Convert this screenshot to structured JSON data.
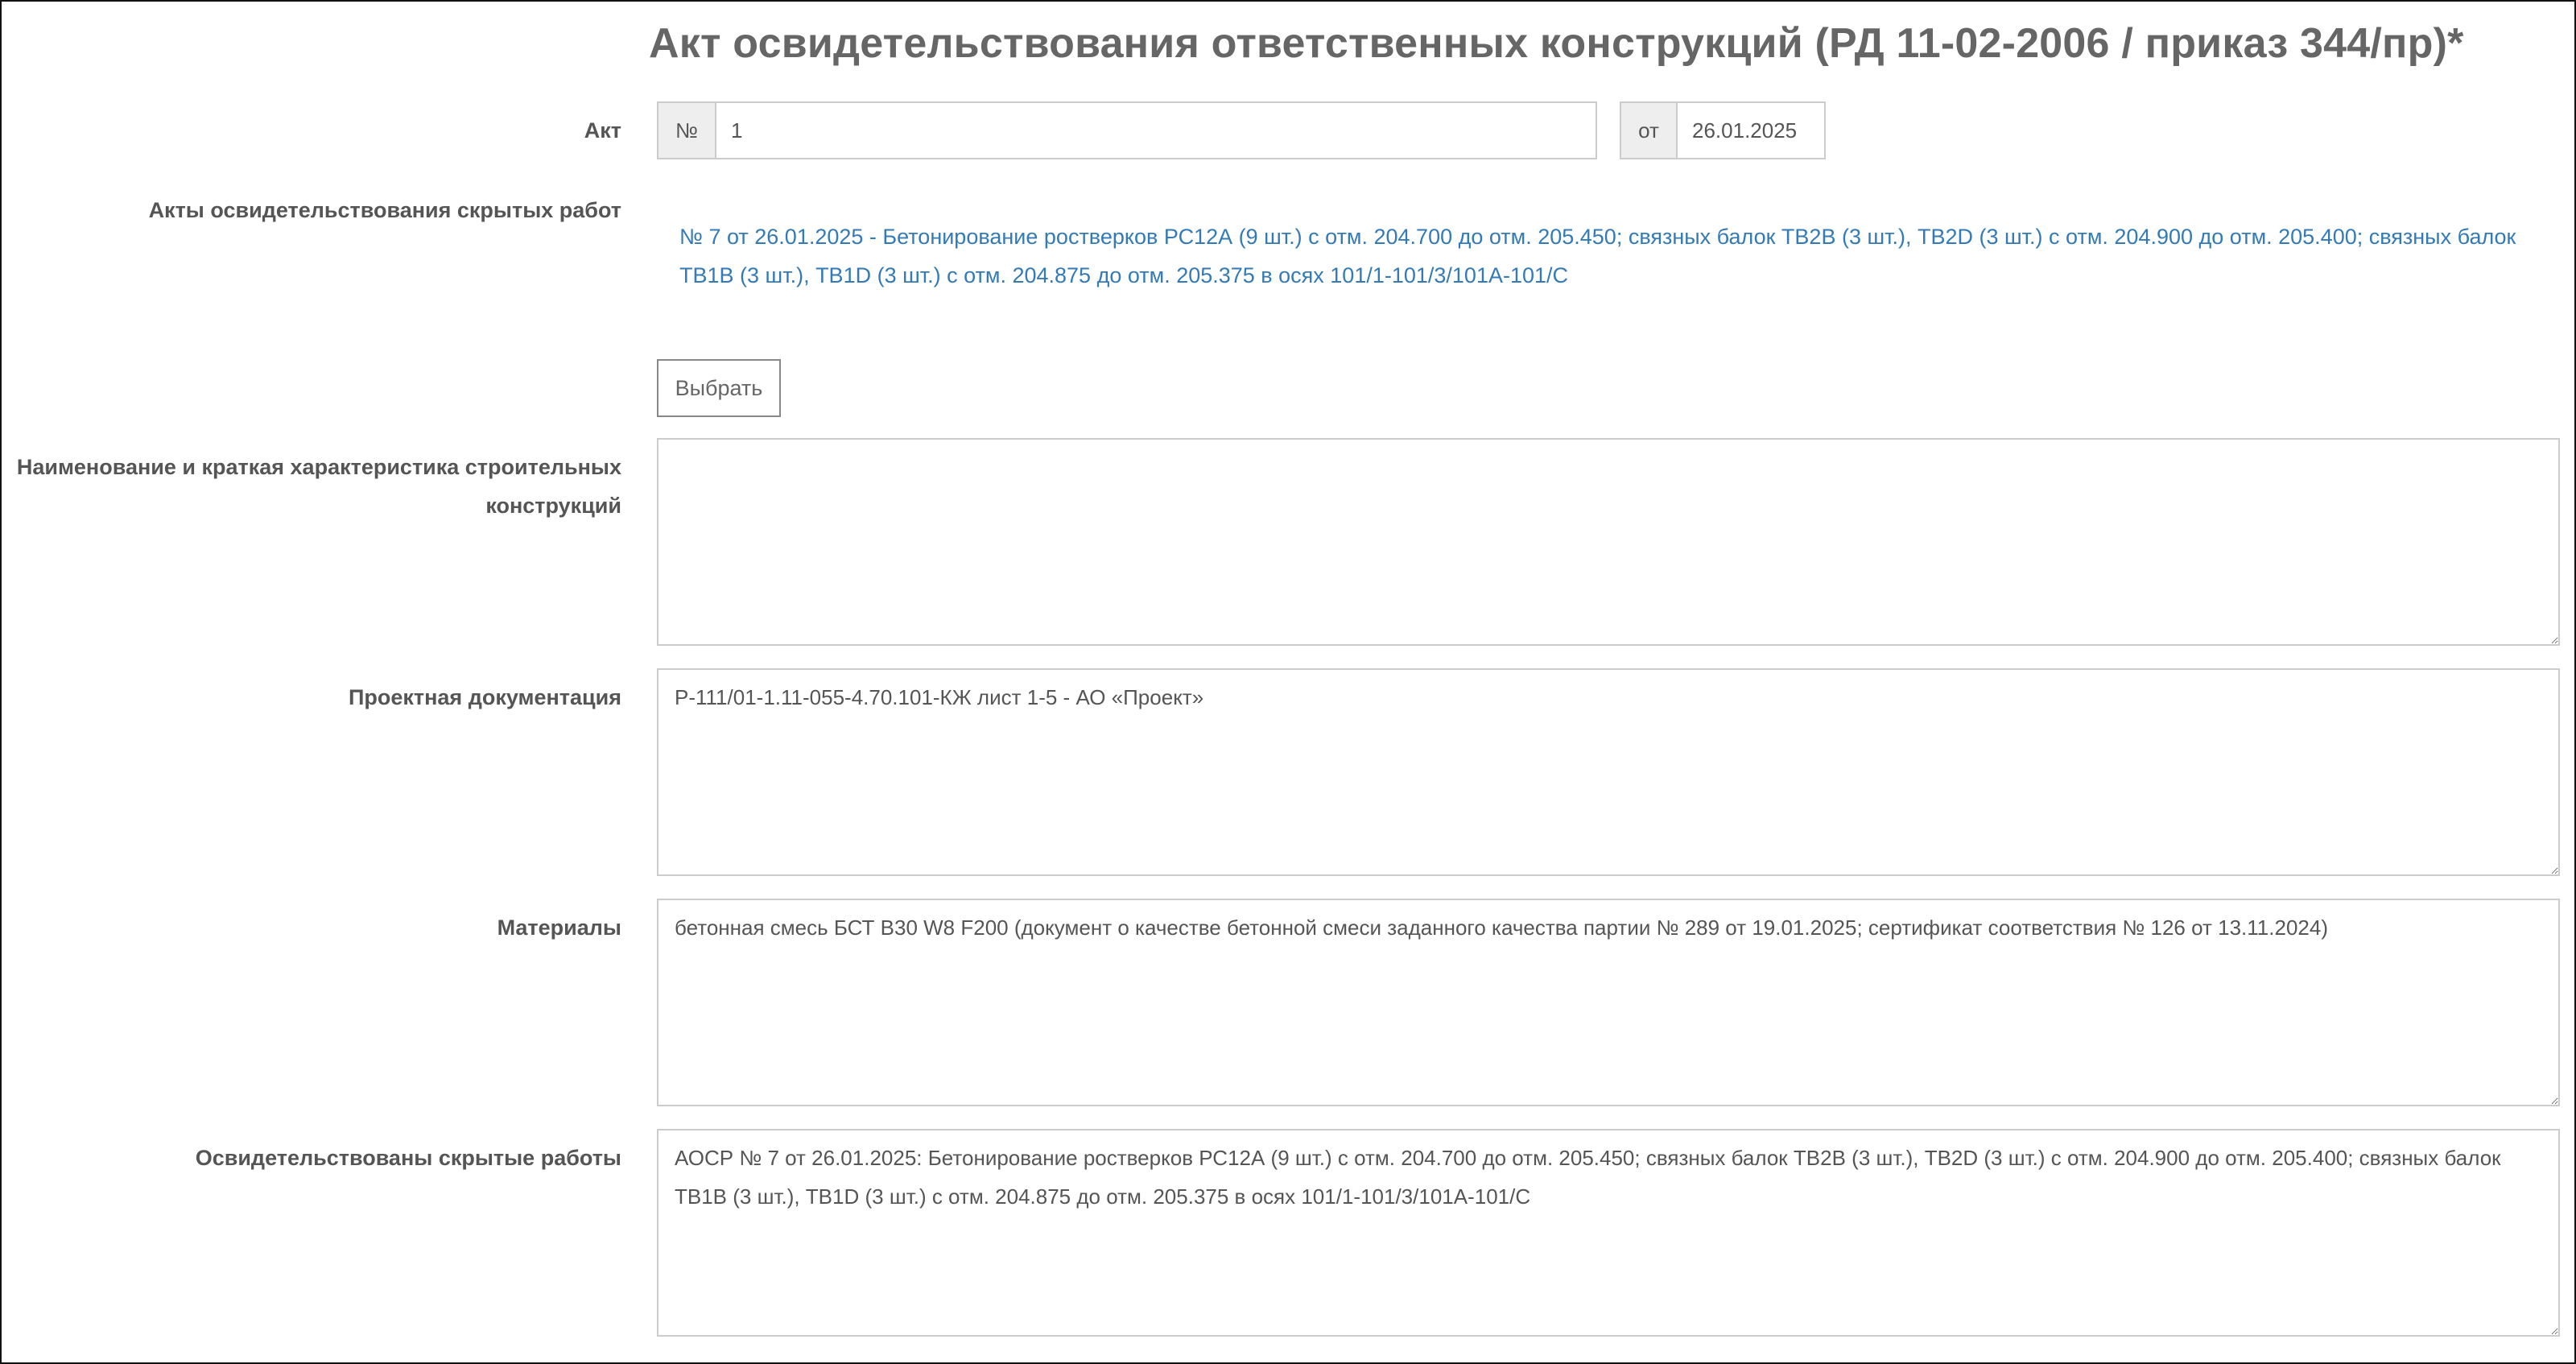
{
  "title": "Акт освидетельствования ответственных конструкций (РД 11-02-2006 / приказ 344/пр)*",
  "act": {
    "label": "Акт",
    "number_prefix": "№",
    "number_value": "1",
    "date_prefix": "от",
    "date_value": "26.01.2025"
  },
  "hidden_works_acts": {
    "label": "Акты освидетельствования скрытых работ",
    "items": [
      "№ 7 от 26.01.2025 - Бетонирование ростверков РС12А (9 шт.) с отм. 204.700 до отм. 205.450; связных балок ТВ2В (3 шт.), ТВ2D (3 шт.) с отм. 204.900 до отм. 205.400; связных балок ТВ1В (3 шт.), ТВ1D (3 шт.) с отм. 204.875 до отм. 205.375 в осях 101/1-101/3/101А-101/С"
    ],
    "select_button": "Выбрать"
  },
  "structures": {
    "label": "Наименование и краткая характеристика строительных конструкций",
    "value": ""
  },
  "project_docs": {
    "label": "Проектная документация",
    "value": "Р-111/01-1.11-055-4.70.101-КЖ лист 1-5 - АО «Проект»"
  },
  "materials": {
    "label": "Материалы",
    "value": "бетонная смесь БСТ В30 W8 F200 (документ о качестве бетонной смеси заданного качества партии № 289 от 19.01.2025; сертификат соответствия № 126 от 13.11.2024)"
  },
  "hidden_works": {
    "label": "Освидетельствованы скрытые работы",
    "value": "АОСР № 7 от 26.01.2025: Бетонирование ростверков РС12А (9 шт.) с отм. 204.700 до отм. 205.450; связных балок ТВ2В (3 шт.), ТВ2D (3 шт.) с отм. 204.900 до отм. 205.400; связных балок ТВ1В (3 шт.), ТВ1D (3 шт.) с отм. 204.875 до отм. 205.375 в осях 101/1-101/3/101А-101/С"
  },
  "colors": {
    "link": "#337ab7",
    "label_text": "#555555",
    "border": "#cccccc",
    "addon_bg": "#eeeeee"
  }
}
